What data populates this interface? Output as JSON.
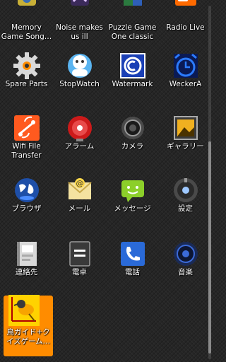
{
  "apps": [
    {
      "label": "Memory\nGame Song…",
      "icon": "memory-game-icon"
    },
    {
      "label": "Noise makes\nus ill",
      "icon": "noise-icon"
    },
    {
      "label": "Puzzle Game\nOne classic",
      "icon": "puzzle-game-icon"
    },
    {
      "label": "Radio Live",
      "icon": "radio-icon"
    },
    {
      "label": "Spare Parts",
      "icon": "gear-icon"
    },
    {
      "label": "StopWatch",
      "icon": "stopwatch-icon"
    },
    {
      "label": "Watermark",
      "icon": "watermark-icon"
    },
    {
      "label": "WeckerA",
      "icon": "alarm-clock-icon"
    },
    {
      "label": "Wifi File\nTransfer",
      "icon": "wifi-transfer-icon"
    },
    {
      "label": "アラーム",
      "icon": "alarm-bell-icon"
    },
    {
      "label": "カメラ",
      "icon": "camera-icon"
    },
    {
      "label": "ギャラリー",
      "icon": "gallery-icon"
    },
    {
      "label": "ブラウザ",
      "icon": "globe-icon"
    },
    {
      "label": "メール",
      "icon": "mail-icon"
    },
    {
      "label": "メッセージ",
      "icon": "message-icon"
    },
    {
      "label": "設定",
      "icon": "settings-icon"
    },
    {
      "label": "連絡先",
      "icon": "contacts-icon"
    },
    {
      "label": "電卓",
      "icon": "calculator-icon"
    },
    {
      "label": "電話",
      "icon": "phone-icon"
    },
    {
      "label": "音楽",
      "icon": "speaker-icon"
    },
    {
      "label": "鳥ガイド+ク\nイズゲーム…",
      "icon": "bird-guide-icon",
      "selected": true
    }
  ],
  "colors": {
    "background": "#262626",
    "selected": "#ff8c00",
    "label": "#ffffff"
  }
}
